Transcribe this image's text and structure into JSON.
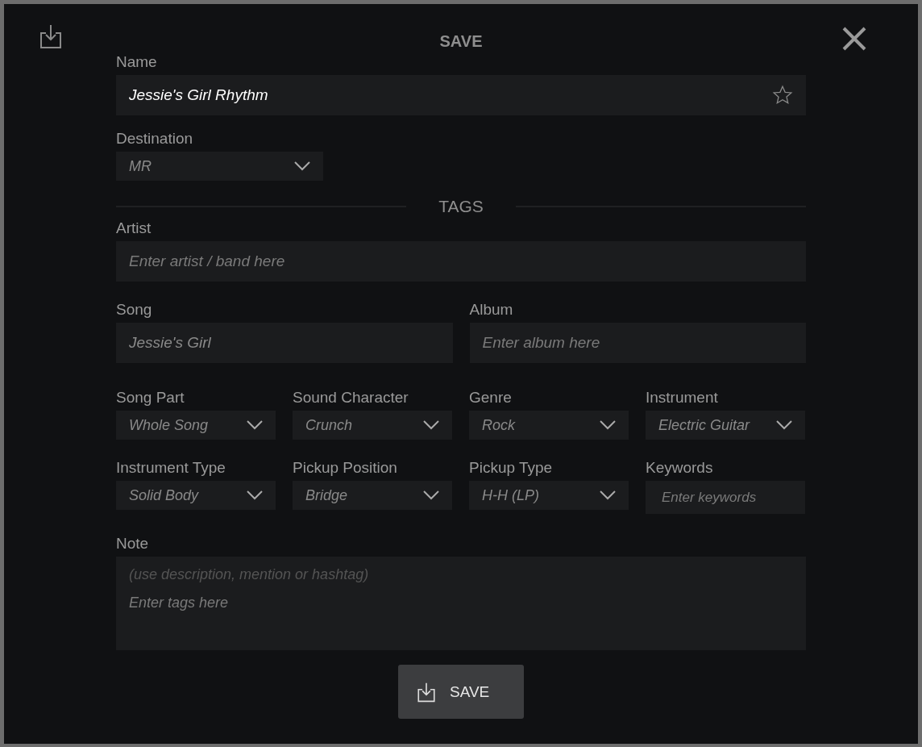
{
  "dialog": {
    "title": "SAVE"
  },
  "name": {
    "label": "Name",
    "value": "Jessie's Girl Rhythm",
    "favorite": false
  },
  "destination": {
    "label": "Destination",
    "value": "MR"
  },
  "tags_heading": "TAGS",
  "artist": {
    "label": "Artist",
    "placeholder": "Enter artist / band here"
  },
  "song": {
    "label": "Song",
    "value": "Jessie's Girl"
  },
  "album": {
    "label": "Album",
    "placeholder": "Enter album here"
  },
  "tag_fields": [
    {
      "kind": "dropdown",
      "label": "Song Part",
      "value": "Whole Song"
    },
    {
      "kind": "dropdown",
      "label": "Sound Character",
      "value": "Crunch"
    },
    {
      "kind": "dropdown",
      "label": "Genre",
      "value": "Rock"
    },
    {
      "kind": "dropdown",
      "label": "Instrument",
      "value": "Electric Guitar"
    },
    {
      "kind": "dropdown",
      "label": "Instrument Type",
      "value": "Solid Body"
    },
    {
      "kind": "dropdown",
      "label": "Pickup Position",
      "value": "Bridge"
    },
    {
      "kind": "dropdown",
      "label": "Pickup Type",
      "value": "H-H (LP)"
    },
    {
      "kind": "text",
      "label": "Keywords",
      "placeholder": "Enter keywords"
    }
  ],
  "note": {
    "label": "Note",
    "hint": "(use description, mention or hashtag)",
    "placeholder": "Enter tags here"
  },
  "save_button": "SAVE"
}
